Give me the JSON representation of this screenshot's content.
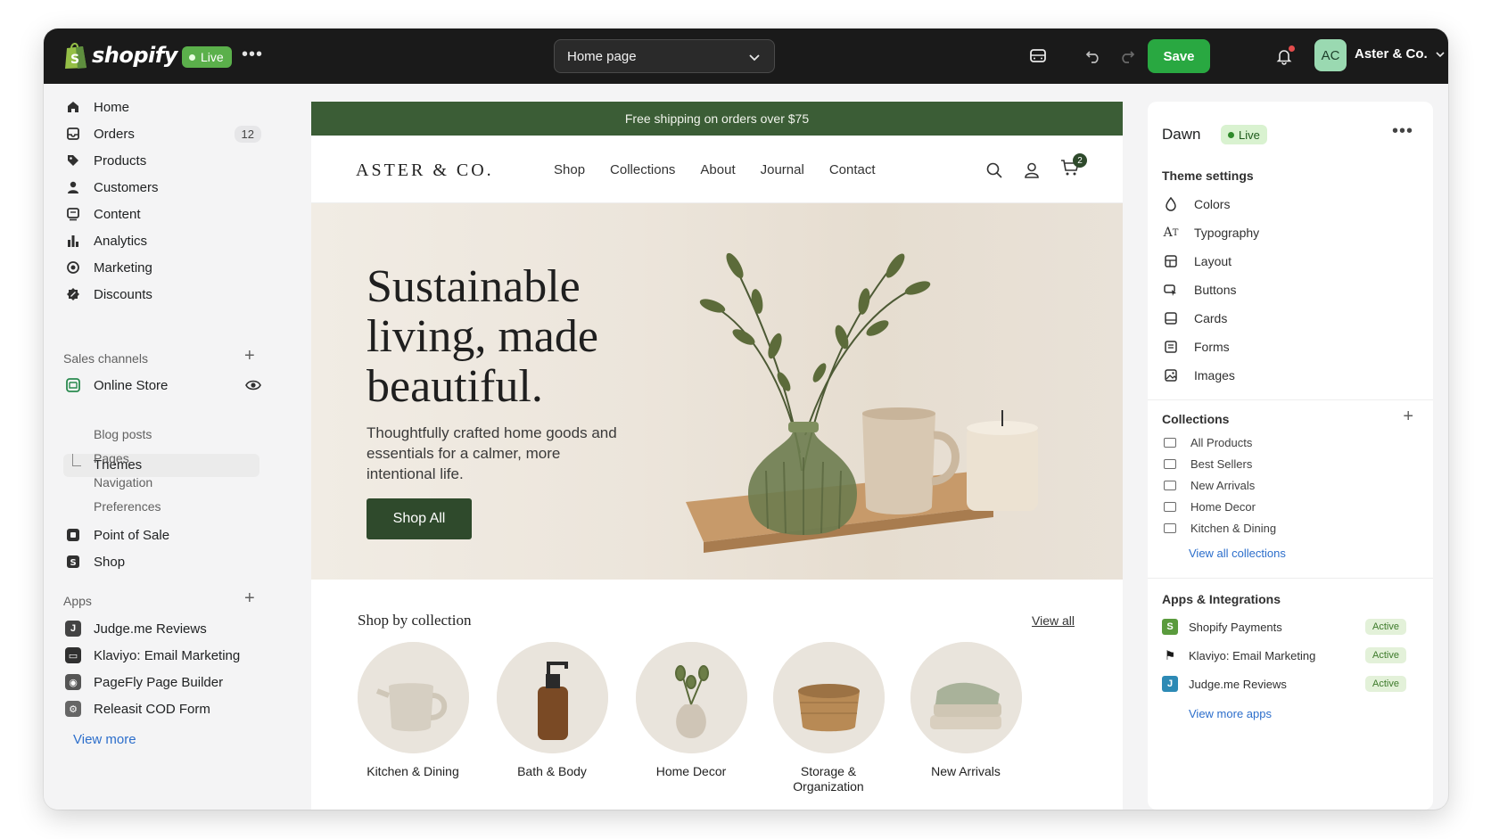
{
  "topbar": {
    "brand": "shopify",
    "status": "Live",
    "page_select": "Home page",
    "save_label": "Save",
    "avatar_initials": "AC",
    "store_name": "Aster & Co."
  },
  "sidebar": {
    "nav": [
      {
        "label": "Home",
        "icon": "home-icon"
      },
      {
        "label": "Orders",
        "icon": "orders-icon",
        "count": "12"
      },
      {
        "label": "Products",
        "icon": "tag-icon"
      },
      {
        "label": "Customers",
        "icon": "person-icon"
      },
      {
        "label": "Content",
        "icon": "content-icon"
      },
      {
        "label": "Analytics",
        "icon": "bar-chart-icon"
      },
      {
        "label": "Marketing",
        "icon": "target-icon"
      },
      {
        "label": "Discounts",
        "icon": "discount-icon"
      }
    ],
    "sales_channels_label": "Sales channels",
    "online_store": "Online Store",
    "themes": "Themes",
    "online_store_sub": [
      "Blog posts",
      "Pages",
      "Navigation",
      "Preferences"
    ],
    "point_of_sale": "Point of Sale",
    "shop": "Shop",
    "apps_label": "Apps",
    "apps": [
      "Judge.me Reviews",
      "Klaviyo: Email Marketing",
      "PageFly Page Builder",
      "Releasit COD Form"
    ],
    "view_more": "View more"
  },
  "preview": {
    "announcement": "Free shipping on orders over $75",
    "logo": "ASTER & CO.",
    "nav": [
      "Shop",
      "Collections",
      "About",
      "Journal",
      "Contact"
    ],
    "cart_count": "2",
    "hero_title_lines": [
      "Sustainable",
      "living, made",
      "beautiful."
    ],
    "hero_subtitle": "Thoughtfully crafted home goods and essentials for a calmer, more intentional life.",
    "hero_button": "Shop All",
    "collections_title": "Shop by collection",
    "collections_view_all": "View all",
    "collections": [
      {
        "label": "Kitchen & Dining",
        "icon": "mug-icon"
      },
      {
        "label": "Bath & Body",
        "icon": "pump-bottle-icon"
      },
      {
        "label": "Home Decor",
        "icon": "vase-icon"
      },
      {
        "label": "Storage & Organization",
        "icon": "basket-icon"
      },
      {
        "label": "New Arrivals",
        "icon": "towels-icon"
      }
    ]
  },
  "rpanel": {
    "theme_name": "Dawn",
    "theme_status": "Live",
    "theme_settings_label": "Theme settings",
    "theme_settings": [
      {
        "label": "Colors",
        "icon": "drop-icon"
      },
      {
        "label": "Typography",
        "icon": "type-icon"
      },
      {
        "label": "Layout",
        "icon": "layout-icon"
      },
      {
        "label": "Buttons",
        "icon": "button-icon"
      },
      {
        "label": "Cards",
        "icon": "card-icon"
      },
      {
        "label": "Forms",
        "icon": "form-icon"
      },
      {
        "label": "Images",
        "icon": "image-icon"
      }
    ],
    "collections_label": "Collections",
    "collections": [
      "All Products",
      "Best Sellers",
      "New Arrivals",
      "Home Decor",
      "Kitchen & Dining"
    ],
    "view_all_collections": "View all collections",
    "apps_label": "Apps & Integrations",
    "apps": [
      {
        "label": "Shopify Payments",
        "status": "Active",
        "color": "#5a9b3d"
      },
      {
        "label": "Klaviyo: Email Marketing",
        "status": "Active",
        "color": "#1a1a1a"
      },
      {
        "label": "Judge.me Reviews",
        "status": "Active",
        "color": "#2d8ab5"
      }
    ],
    "view_more_apps": "View more apps"
  },
  "colors": {
    "accent_green": "#29a841",
    "brand_dark_green": "#3b5d36",
    "link_blue": "#2c6ecb"
  }
}
